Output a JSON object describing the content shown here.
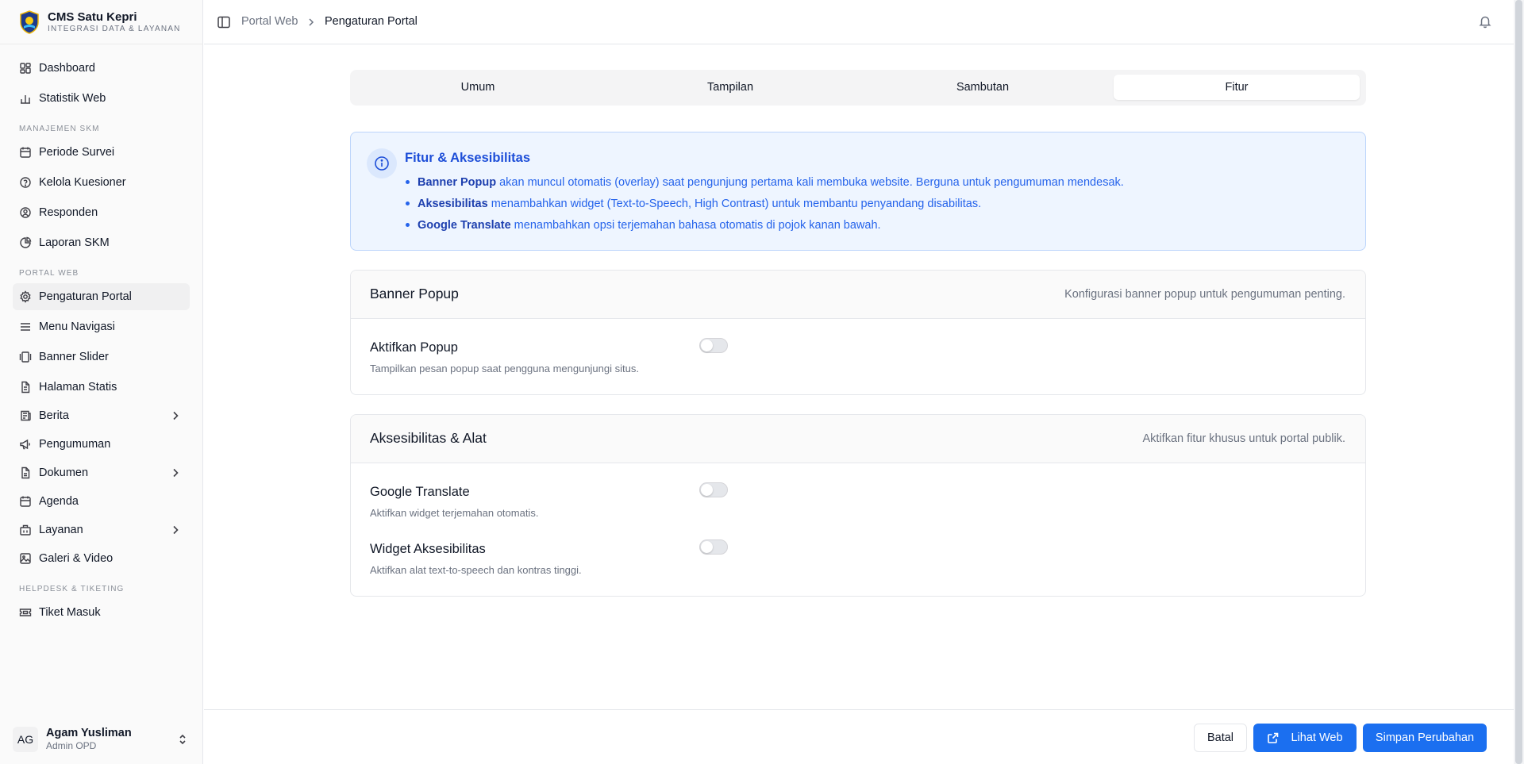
{
  "brand": {
    "name": "CMS Satu Kepri",
    "subtitle": "INTEGRASI DATA & LAYANAN"
  },
  "sidebar": {
    "items_top": [
      {
        "label": "Dashboard",
        "icon": "dashboard-icon"
      },
      {
        "label": "Statistik Web",
        "icon": "bar-chart-icon"
      }
    ],
    "section_skm": "MANAJEMEN SKM",
    "items_skm": [
      {
        "label": "Periode Survei",
        "icon": "calendar-icon"
      },
      {
        "label": "Kelola Kuesioner",
        "icon": "help-circle-icon"
      },
      {
        "label": "Responden",
        "icon": "users-icon"
      },
      {
        "label": "Laporan SKM",
        "icon": "pie-chart-icon"
      }
    ],
    "section_portal": "PORTAL WEB",
    "items_portal": [
      {
        "label": "Pengaturan Portal",
        "icon": "gear-icon"
      },
      {
        "label": "Menu Navigasi",
        "icon": "menu-icon"
      },
      {
        "label": "Banner Slider",
        "icon": "gallery-icon"
      },
      {
        "label": "Halaman Statis",
        "icon": "file-icon"
      },
      {
        "label": "Berita",
        "icon": "newspaper-icon"
      },
      {
        "label": "Pengumuman",
        "icon": "megaphone-icon"
      },
      {
        "label": "Dokumen",
        "icon": "document-icon"
      },
      {
        "label": "Agenda",
        "icon": "calendar-icon"
      },
      {
        "label": "Layanan",
        "icon": "building-icon"
      },
      {
        "label": "Galeri & Video",
        "icon": "image-icon"
      }
    ],
    "section_helpdesk": "HELPDESK & TIKETING",
    "items_helpdesk": [
      {
        "label": "Tiket Masuk",
        "icon": "ticket-icon"
      }
    ]
  },
  "user": {
    "initials": "AG",
    "name": "Agam Yusliman",
    "role": "Admin OPD"
  },
  "breadcrumb": {
    "parent": "Portal Web",
    "current": "Pengaturan Portal"
  },
  "tabs": [
    "Umum",
    "Tampilan",
    "Sambutan",
    "Fitur"
  ],
  "active_tab": "Fitur",
  "info": {
    "title": "Fitur & Aksesibilitas",
    "items": [
      {
        "bold": "Banner Popup",
        "text": " akan muncul otomatis (overlay) saat pengunjung pertama kali membuka website. Berguna untuk pengumuman mendesak."
      },
      {
        "bold": "Aksesibilitas",
        "text": " menambahkan widget (Text-to-Speech, High Contrast) untuk membantu penyandang disabilitas."
      },
      {
        "bold": "Google Translate",
        "text": " menambahkan opsi terjemahan bahasa otomatis di pojok kanan bawah."
      }
    ]
  },
  "banner_popup": {
    "title": "Banner Popup",
    "description": "Konfigurasi banner popup untuk pengumuman penting.",
    "enable_label": "Aktifkan Popup",
    "enable_help": "Tampilkan pesan popup saat pengguna mengunjungi situs.",
    "enabled": false
  },
  "accessibility": {
    "title": "Aksesibilitas & Alat",
    "description": "Aktifkan fitur khusus untuk portal publik.",
    "translate_label": "Google Translate",
    "translate_help": "Aktifkan widget terjemahan otomatis.",
    "translate_enabled": false,
    "widget_label": "Widget Aksesibilitas",
    "widget_help": "Aktifkan alat text-to-speech dan kontras tinggi.",
    "widget_enabled": false
  },
  "footer": {
    "cancel": "Batal",
    "view": "Lihat Web",
    "save": "Simpan Perubahan"
  },
  "colors": {
    "primary": "#1b6ff0",
    "info_bg": "#eef5ff",
    "info_text": "#2563eb"
  }
}
